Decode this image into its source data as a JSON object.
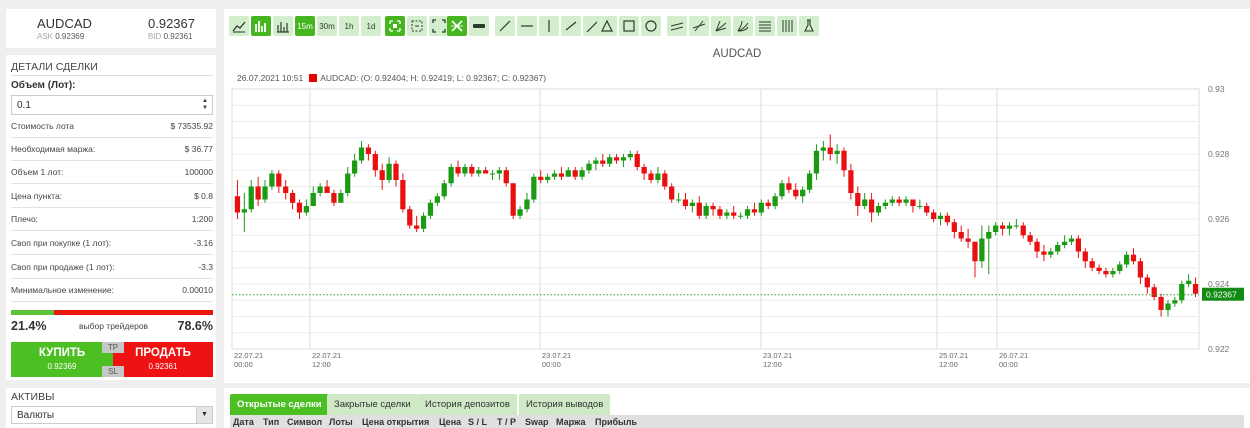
{
  "quote": {
    "symbol": "AUDCAD",
    "bid_big": "0.92367",
    "ask_label": "ASK",
    "ask_value": "0.92369",
    "bid_label": "BID",
    "bid_value": "0.92361"
  },
  "details": {
    "title": "ДЕТАЛИ СДЕЛКИ",
    "volume_label": "Объем (Лот):",
    "volume_value": "0.1",
    "rows": [
      {
        "label": "Стоимость лота",
        "value": "$ 73535.92"
      },
      {
        "label": "Необходимая маржа:",
        "value": "$ 36.77"
      },
      {
        "label": "Объем 1 лот:",
        "value": "100000"
      },
      {
        "label": "Цена пункта:",
        "value": "$ 0.8"
      },
      {
        "label": "Плечо:",
        "value": "1:200"
      },
      {
        "label": "Своп при покупке (1 лот):",
        "value": "-3.16"
      },
      {
        "label": "Своп при продаже (1 лот):",
        "value": "-3.3"
      },
      {
        "label": "Минимальное изменение:",
        "value": "0.00010"
      }
    ],
    "sentiment": {
      "buy_pct": "21.4%",
      "sell_pct": "78.6%",
      "caption": "выбор трейдеров",
      "buy_fraction": 0.214
    },
    "buy": {
      "label": "КУПИТЬ",
      "price": "0.92369"
    },
    "sell": {
      "label": "ПРОДАТЬ",
      "price": "0.92361"
    },
    "tp_label": "TP",
    "sl_label": "SL"
  },
  "assets": {
    "title": "АКТИВЫ",
    "selected": "Валюты"
  },
  "toolbar": {
    "buttons": [
      {
        "name": "line-chart-tool",
        "icon": "line-chart-icon",
        "text": "",
        "on": false
      },
      {
        "name": "bar-chart-tool",
        "icon": "bar-chart-icon",
        "text": "",
        "on": true
      },
      {
        "name": "ohlc-chart-tool",
        "icon": "ohlc-chart-icon",
        "text": "",
        "on": false
      },
      {
        "name": "timeframe-15m",
        "icon": "",
        "text": "15m",
        "on": true
      },
      {
        "name": "timeframe-30m",
        "icon": "",
        "text": "30m",
        "on": false
      },
      {
        "name": "timeframe-1h",
        "icon": "",
        "text": "1h",
        "on": false
      },
      {
        "name": "timeframe-1d",
        "icon": "",
        "text": "1d",
        "on": false
      },
      {
        "name": "zoom-in-tool",
        "icon": "zoom-in-icon",
        "text": "",
        "on": true
      },
      {
        "name": "zoom-reset-tool",
        "icon": "zoom-reset-icon",
        "text": "",
        "on": false
      },
      {
        "name": "fullscreen-tool",
        "icon": "fullscreen-icon",
        "text": "",
        "on": false
      },
      {
        "name": "crosshair-tool",
        "icon": "crosshair-icon",
        "text": "",
        "on": true
      },
      {
        "name": "ruler-tool",
        "icon": "ruler-icon",
        "text": "",
        "on": false
      },
      {
        "name": "trendline-tool",
        "icon": "trendline-icon",
        "text": "",
        "on": false
      },
      {
        "name": "horizontal-line-tool",
        "icon": "horizontal-line-icon",
        "text": "",
        "on": false
      },
      {
        "name": "vertical-line-tool",
        "icon": "vertical-line-icon",
        "text": "",
        "on": false
      },
      {
        "name": "ray-tool",
        "icon": "ray-icon",
        "text": "",
        "on": false
      },
      {
        "name": "extended-line-tool",
        "icon": "extended-line-icon",
        "text": "",
        "on": false
      },
      {
        "name": "triangle-tool",
        "icon": "triangle-icon",
        "text": "",
        "on": false
      },
      {
        "name": "rectangle-tool",
        "icon": "rectangle-icon",
        "text": "",
        "on": false
      },
      {
        "name": "circle-tool",
        "icon": "circle-icon",
        "text": "",
        "on": false
      },
      {
        "name": "parallel-channel-tool",
        "icon": "parallel-channel-icon",
        "text": "",
        "on": false
      },
      {
        "name": "arrow-tool",
        "icon": "arrow-icon",
        "text": "",
        "on": false
      },
      {
        "name": "pitchfork-tool",
        "icon": "pitchfork-icon",
        "text": "",
        "on": false
      },
      {
        "name": "fibonacci-fan-tool",
        "icon": "fibonacci-fan-icon",
        "text": "",
        "on": false
      },
      {
        "name": "fibonacci-levels-tool",
        "icon": "fibonacci-levels-icon",
        "text": "",
        "on": false
      },
      {
        "name": "gann-tool",
        "icon": "gann-icon",
        "text": "",
        "on": false
      },
      {
        "name": "indicators-tool",
        "icon": "flask-icon",
        "text": "",
        "on": false
      }
    ]
  },
  "chart_data": {
    "type": "candlestick",
    "title": "AUDCAD",
    "ohlc_timestamp": "26.07.2021 10:51",
    "ohlc_text": "AUDCAD: (O: 0.92404; H: 0.92419; L: 0.92367; C: 0.92367)",
    "last_price": "0.92367",
    "ylim": [
      0.922,
      0.93
    ],
    "y_ticks": [
      0.93,
      0.928,
      0.926,
      0.924,
      0.922
    ],
    "x_tick_labels": [
      {
        "date": "22.07.21",
        "time": "00:00"
      },
      {
        "date": "22.07.21",
        "time": "12:00"
      },
      {
        "date": "23.07.21",
        "time": "00:00"
      },
      {
        "date": "23.07.21",
        "time": "12:00"
      },
      {
        "date": "25.07.21",
        "time": "12:00"
      },
      {
        "date": "26.07.21",
        "time": "00:00"
      }
    ],
    "candles": [
      [
        0.9267,
        0.9272,
        0.926,
        0.9262
      ],
      [
        0.9262,
        0.9268,
        0.9256,
        0.9263
      ],
      [
        0.9263,
        0.9272,
        0.9262,
        0.927
      ],
      [
        0.927,
        0.9273,
        0.9264,
        0.9266
      ],
      [
        0.9266,
        0.9272,
        0.9265,
        0.927
      ],
      [
        0.927,
        0.9275,
        0.9269,
        0.9274
      ],
      [
        0.9274,
        0.9275,
        0.9268,
        0.927
      ],
      [
        0.927,
        0.9272,
        0.9266,
        0.9268
      ],
      [
        0.9268,
        0.9269,
        0.9263,
        0.9265
      ],
      [
        0.9265,
        0.9266,
        0.926,
        0.9262
      ],
      [
        0.9262,
        0.9266,
        0.9261,
        0.9264
      ],
      [
        0.9264,
        0.927,
        0.9264,
        0.9268
      ],
      [
        0.9268,
        0.9271,
        0.9267,
        0.927
      ],
      [
        0.927,
        0.9272,
        0.9268,
        0.9268
      ],
      [
        0.9268,
        0.9269,
        0.9264,
        0.9265
      ],
      [
        0.9265,
        0.9269,
        0.9265,
        0.9268
      ],
      [
        0.9268,
        0.9276,
        0.9267,
        0.9274
      ],
      [
        0.9274,
        0.928,
        0.9273,
        0.9278
      ],
      [
        0.9278,
        0.9284,
        0.9277,
        0.9282
      ],
      [
        0.9282,
        0.9283,
        0.9278,
        0.928
      ],
      [
        0.928,
        0.9281,
        0.9273,
        0.9275
      ],
      [
        0.9275,
        0.9277,
        0.9269,
        0.9272
      ],
      [
        0.9272,
        0.9279,
        0.9271,
        0.9277
      ],
      [
        0.9277,
        0.9278,
        0.927,
        0.9272
      ],
      [
        0.9272,
        0.9274,
        0.9262,
        0.9263
      ],
      [
        0.9263,
        0.9264,
        0.9257,
        0.9258
      ],
      [
        0.9258,
        0.9261,
        0.9256,
        0.9257
      ],
      [
        0.9257,
        0.9262,
        0.9256,
        0.9261
      ],
      [
        0.9261,
        0.9266,
        0.926,
        0.9265
      ],
      [
        0.9265,
        0.9268,
        0.9264,
        0.9267
      ],
      [
        0.9267,
        0.9272,
        0.9266,
        0.9271
      ],
      [
        0.9271,
        0.9277,
        0.927,
        0.9276
      ],
      [
        0.9276,
        0.9278,
        0.9273,
        0.9274
      ],
      [
        0.9274,
        0.9277,
        0.9273,
        0.9276
      ],
      [
        0.9276,
        0.9277,
        0.9273,
        0.9274
      ],
      [
        0.9274,
        0.9276,
        0.9273,
        0.9275
      ],
      [
        0.9275,
        0.9276,
        0.9274,
        0.9274
      ],
      [
        0.9274,
        0.9275,
        0.9272,
        0.9274
      ],
      [
        0.9274,
        0.9276,
        0.9272,
        0.9275
      ],
      [
        0.9275,
        0.9276,
        0.927,
        0.9271
      ],
      [
        0.9271,
        0.9271,
        0.926,
        0.9261
      ],
      [
        0.9261,
        0.9264,
        0.926,
        0.9263
      ],
      [
        0.9263,
        0.9268,
        0.9262,
        0.9266
      ],
      [
        0.9266,
        0.9274,
        0.9265,
        0.9273
      ],
      [
        0.9273,
        0.9275,
        0.9271,
        0.9272
      ],
      [
        0.9272,
        0.9274,
        0.9271,
        0.9273
      ],
      [
        0.9273,
        0.9275,
        0.9272,
        0.9274
      ],
      [
        0.9274,
        0.9276,
        0.9272,
        0.9273
      ],
      [
        0.9273,
        0.9276,
        0.9273,
        0.9275
      ],
      [
        0.9275,
        0.9276,
        0.9272,
        0.9273
      ],
      [
        0.9273,
        0.9276,
        0.9272,
        0.9275
      ],
      [
        0.9275,
        0.9278,
        0.9274,
        0.9277
      ],
      [
        0.9277,
        0.9279,
        0.9275,
        0.9278
      ],
      [
        0.9278,
        0.928,
        0.9276,
        0.9277
      ],
      [
        0.9277,
        0.928,
        0.9276,
        0.9279
      ],
      [
        0.9279,
        0.928,
        0.9277,
        0.9278
      ],
      [
        0.9278,
        0.928,
        0.9276,
        0.9279
      ],
      [
        0.9279,
        0.9281,
        0.9278,
        0.928
      ],
      [
        0.928,
        0.9281,
        0.9275,
        0.9276
      ],
      [
        0.9276,
        0.9277,
        0.9272,
        0.9274
      ],
      [
        0.9274,
        0.9275,
        0.9271,
        0.9272
      ],
      [
        0.9272,
        0.9276,
        0.9271,
        0.9274
      ],
      [
        0.9274,
        0.9275,
        0.9269,
        0.927
      ],
      [
        0.927,
        0.9271,
        0.9265,
        0.9266
      ],
      [
        0.9266,
        0.9268,
        0.9265,
        0.9266
      ],
      [
        0.9266,
        0.9268,
        0.9263,
        0.9264
      ],
      [
        0.9264,
        0.9266,
        0.9262,
        0.9265
      ],
      [
        0.9265,
        0.9267,
        0.926,
        0.9261
      ],
      [
        0.9261,
        0.9265,
        0.926,
        0.9264
      ],
      [
        0.9264,
        0.9265,
        0.9261,
        0.9263
      ],
      [
        0.9263,
        0.9264,
        0.926,
        0.9261
      ],
      [
        0.9261,
        0.9263,
        0.926,
        0.9262
      ],
      [
        0.9262,
        0.9264,
        0.926,
        0.9261
      ],
      [
        0.9261,
        0.9262,
        0.926,
        0.9261
      ],
      [
        0.9261,
        0.9264,
        0.926,
        0.9263
      ],
      [
        0.9263,
        0.9265,
        0.9261,
        0.9262
      ],
      [
        0.9262,
        0.9266,
        0.9261,
        0.9265
      ],
      [
        0.9265,
        0.9266,
        0.9263,
        0.9264
      ],
      [
        0.9264,
        0.9268,
        0.9263,
        0.9267
      ],
      [
        0.9267,
        0.9272,
        0.9266,
        0.9271
      ],
      [
        0.9271,
        0.9273,
        0.9268,
        0.9269
      ],
      [
        0.9269,
        0.9271,
        0.9266,
        0.9267
      ],
      [
        0.9267,
        0.927,
        0.9265,
        0.9269
      ],
      [
        0.9269,
        0.9275,
        0.9268,
        0.9274
      ],
      [
        0.9274,
        0.9283,
        0.9272,
        0.9281
      ],
      [
        0.9281,
        0.9284,
        0.9278,
        0.9282
      ],
      [
        0.9282,
        0.9286,
        0.9278,
        0.928
      ],
      [
        0.928,
        0.9283,
        0.9277,
        0.9281
      ],
      [
        0.9281,
        0.9282,
        0.9273,
        0.9275
      ],
      [
        0.9275,
        0.9277,
        0.9266,
        0.9268
      ],
      [
        0.9268,
        0.927,
        0.9261,
        0.9264
      ],
      [
        0.9264,
        0.9268,
        0.9263,
        0.9266
      ],
      [
        0.9266,
        0.9268,
        0.9259,
        0.9262
      ],
      [
        0.9262,
        0.9265,
        0.9261,
        0.9264
      ],
      [
        0.9264,
        0.9266,
        0.9263,
        0.9265
      ],
      [
        0.9265,
        0.9267,
        0.9264,
        0.9266
      ],
      [
        0.9266,
        0.9267,
        0.9264,
        0.9265
      ],
      [
        0.9265,
        0.9267,
        0.9264,
        0.9266
      ],
      [
        0.9266,
        0.9266,
        0.9262,
        0.9264
      ],
      [
        0.9264,
        0.9266,
        0.9263,
        0.9264
      ],
      [
        0.9264,
        0.9265,
        0.9261,
        0.9262
      ],
      [
        0.9262,
        0.9263,
        0.9259,
        0.926
      ],
      [
        0.926,
        0.9262,
        0.9258,
        0.9261
      ],
      [
        0.9261,
        0.9262,
        0.9258,
        0.9259
      ],
      [
        0.9259,
        0.926,
        0.9254,
        0.9256
      ],
      [
        0.9256,
        0.9258,
        0.9253,
        0.9254
      ],
      [
        0.9254,
        0.9257,
        0.9251,
        0.9253
      ],
      [
        0.9253,
        0.9253,
        0.9242,
        0.9247
      ],
      [
        0.9247,
        0.9258,
        0.9245,
        0.9254
      ],
      [
        0.9254,
        0.9258,
        0.9243,
        0.9256
      ],
      [
        0.9256,
        0.9259,
        0.9255,
        0.9258
      ],
      [
        0.9258,
        0.9259,
        0.9255,
        0.9257
      ],
      [
        0.9257,
        0.9259,
        0.9255,
        0.9258
      ],
      [
        0.9258,
        0.926,
        0.9257,
        0.9258
      ],
      [
        0.9258,
        0.9259,
        0.9254,
        0.9255
      ],
      [
        0.9255,
        0.9256,
        0.9252,
        0.9253
      ],
      [
        0.9253,
        0.9254,
        0.9248,
        0.925
      ],
      [
        0.925,
        0.9252,
        0.9247,
        0.9249
      ],
      [
        0.9249,
        0.9251,
        0.9248,
        0.925
      ],
      [
        0.925,
        0.9253,
        0.9249,
        0.9252
      ],
      [
        0.9252,
        0.9255,
        0.9251,
        0.9253
      ],
      [
        0.9253,
        0.9255,
        0.9252,
        0.9254
      ],
      [
        0.9254,
        0.9255,
        0.9248,
        0.925
      ],
      [
        0.925,
        0.9251,
        0.9245,
        0.9247
      ],
      [
        0.9247,
        0.9248,
        0.9244,
        0.9245
      ],
      [
        0.9245,
        0.9246,
        0.9243,
        0.9244
      ],
      [
        0.9244,
        0.9245,
        0.9242,
        0.9243
      ],
      [
        0.9243,
        0.9245,
        0.9242,
        0.9244
      ],
      [
        0.9244,
        0.9247,
        0.9243,
        0.9246
      ],
      [
        0.9246,
        0.925,
        0.9245,
        0.9249
      ],
      [
        0.9249,
        0.9251,
        0.9246,
        0.9247
      ],
      [
        0.9247,
        0.9248,
        0.924,
        0.9242
      ],
      [
        0.9242,
        0.9243,
        0.9237,
        0.9239
      ],
      [
        0.9239,
        0.924,
        0.9235,
        0.9236
      ],
      [
        0.9236,
        0.9237,
        0.923,
        0.9232
      ],
      [
        0.9232,
        0.9235,
        0.923,
        0.9234
      ],
      [
        0.9234,
        0.9236,
        0.9233,
        0.9235
      ],
      [
        0.9235,
        0.9241,
        0.9234,
        0.924
      ],
      [
        0.924,
        0.9243,
        0.9239,
        0.9241
      ],
      [
        0.924,
        0.9242,
        0.9236,
        0.9237
      ]
    ]
  },
  "trades": {
    "tabs": [
      "Открытые сделки",
      "Закрытые сделки",
      "История депозитов",
      "История выводов"
    ],
    "columns": [
      "Дата",
      "Тип",
      "Символ",
      "Лоты",
      "Цена открытия",
      "Цена",
      "S / L",
      "T / P",
      "Swap",
      "Маржа",
      "Прибыль"
    ]
  },
  "colors": {
    "up": "#1b9a14",
    "down": "#e81010",
    "accent": "#4cbf22",
    "sell": "#ee1212",
    "price_tag": "#138a13"
  }
}
